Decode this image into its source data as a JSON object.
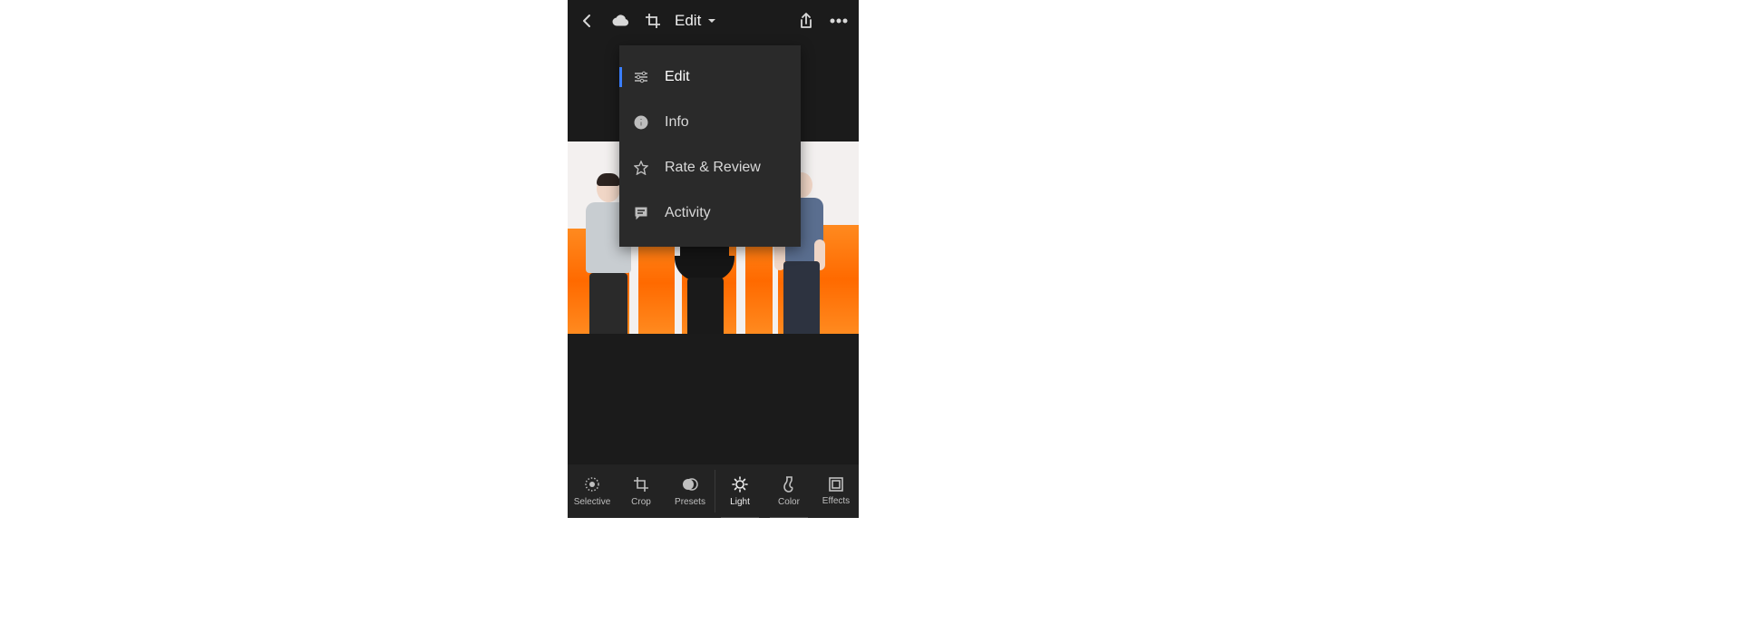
{
  "topbar": {
    "mode_label": "Edit"
  },
  "dropdown": {
    "items": [
      {
        "label": "Edit",
        "iconName": "sliders-icon",
        "active": true
      },
      {
        "label": "Info",
        "iconName": "info-icon",
        "active": false
      },
      {
        "label": "Rate & Review",
        "iconName": "star-icon",
        "active": false
      },
      {
        "label": "Activity",
        "iconName": "chat-icon",
        "active": false
      }
    ]
  },
  "bottombar": {
    "group1": [
      {
        "label": "Selective",
        "iconName": "radial-icon"
      },
      {
        "label": "Crop",
        "iconName": "crop-icon"
      },
      {
        "label": "Presets",
        "iconName": "presets-icon"
      }
    ],
    "group2": [
      {
        "label": "Light",
        "iconName": "light-icon",
        "selected": true
      },
      {
        "label": "Color",
        "iconName": "color-icon",
        "selected": false
      },
      {
        "label": "Effects",
        "iconName": "effects-icon",
        "selected": false
      }
    ]
  },
  "colors": {
    "accent": "#3a7eff",
    "panel_orange": "#ff7a12"
  }
}
